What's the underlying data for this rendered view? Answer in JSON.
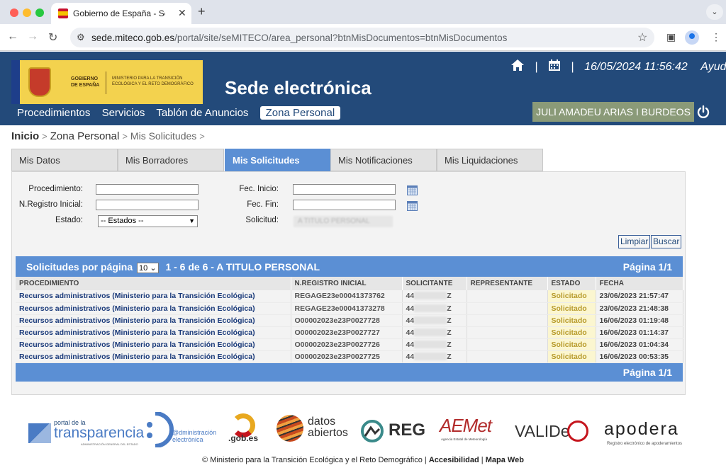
{
  "browser": {
    "tab_title": "Gobierno de España - Sede E",
    "url_host": "sede.miteco.gob.es",
    "url_path": "/portal/site/seMITECO/area_personal?btnMisDocumentos=btnMisDocumentos"
  },
  "header": {
    "logo_line1": "GOBIERNO DE ESPAÑA",
    "logo_line2": "MINISTERIO PARA LA TRANSICIÓN ECOLÓGICA Y EL RETO DEMOGRÁFICO",
    "site_title": "Sede electrónica",
    "datetime": "16/05/2024 11:56:42",
    "help": "Ayuda",
    "nav": [
      "Procedimientos",
      "Servicios",
      "Tablón de Anuncios",
      "Zona Personal"
    ],
    "user": "JULI AMADEU ARIAS I BURDEOS"
  },
  "breadcrumb": {
    "home": "Inicio",
    "zone": "Zona Personal",
    "current": "Mis Solicitudes"
  },
  "tabs": [
    "Mis Datos",
    "Mis Borradores",
    "Mis Solicitudes",
    "Mis Notificaciones",
    "Mis Liquidaciones"
  ],
  "filters": {
    "procedimiento_label": "Procedimiento:",
    "nregistro_label": "N.Registro Inicial:",
    "estado_label": "Estado:",
    "estado_value": "-- Estados --",
    "fec_inicio_label": "Fec. Inicio:",
    "fec_fin_label": "Fec. Fin:",
    "solicitud_label": "Solicitud:",
    "solicitud_value": "A TITULO PERSONAL",
    "limpiar": "Limpiar",
    "buscar": "Buscar"
  },
  "results": {
    "per_page_label": "Solicitudes por página",
    "per_page_value": "10",
    "range": "1 - 6 de 6 - A TITULO PERSONAL",
    "page": "Página 1/1",
    "columns": [
      "PROCEDIMIENTO",
      "N.REGISTRO INICIAL",
      "SOLICITANTE",
      "REPRESENTANTE",
      "ESTADO",
      "FECHA"
    ],
    "rows": [
      {
        "proc": "Recursos administrativos (Ministerio para la Transición Ecológica)",
        "reg": "REGAGE23e00041373762",
        "sol_a": "44",
        "sol_b": "Z",
        "rep": "",
        "estado": "Solicitado",
        "fecha": "23/06/2023 21:57:47"
      },
      {
        "proc": "Recursos administrativos (Ministerio para la Transición Ecológica)",
        "reg": "REGAGE23e00041373278",
        "sol_a": "44",
        "sol_b": "Z",
        "rep": "",
        "estado": "Solicitado",
        "fecha": "23/06/2023 21:48:38"
      },
      {
        "proc": "Recursos administrativos (Ministerio para la Transición Ecológica)",
        "reg": "O00002023e23P0027728",
        "sol_a": "44",
        "sol_b": "Z",
        "rep": "",
        "estado": "Solicitado",
        "fecha": "16/06/2023 01:19:48"
      },
      {
        "proc": "Recursos administrativos (Ministerio para la Transición Ecológica)",
        "reg": "O00002023e23P0027727",
        "sol_a": "44",
        "sol_b": "Z",
        "rep": "",
        "estado": "Solicitado",
        "fecha": "16/06/2023 01:14:37"
      },
      {
        "proc": "Recursos administrativos (Ministerio para la Transición Ecológica)",
        "reg": "O00002023e23P0027726",
        "sol_a": "44",
        "sol_b": "Z",
        "rep": "",
        "estado": "Solicitado",
        "fecha": "16/06/2023 01:04:34"
      },
      {
        "proc": "Recursos administrativos (Ministerio para la Transición Ecológica)",
        "reg": "O00002023e23P0027725",
        "sol_a": "44",
        "sol_b": "Z",
        "rep": "",
        "estado": "Solicitado",
        "fecha": "16/06/2023 00:53:35"
      }
    ]
  },
  "footer": {
    "logo_transparencia_small": "portal de la",
    "logo_transparencia": "transparencia",
    "logo_transparencia_sub": "ADMINISTRACIÓN GENERAL DEL ESTADO",
    "logo_admin": "@dministración electrónica",
    "logo_gob": ".gob.es",
    "logo_datos1": "datos",
    "logo_datos2": "abiertos",
    "logo_reg": "REG",
    "logo_aemet": "AEMet",
    "logo_aemet_sub": "Agencia Estatal de Meteorología",
    "logo_valide": "VALIDe",
    "logo_apodera": "apodera",
    "logo_apodera_sub": "Registro electrónico de apoderamientos",
    "copyright": "© Ministerio para la Transición Ecológica y el Reto Demográfico",
    "accesibilidad": "Accesibilidad",
    "mapa": "Mapa Web"
  },
  "colors": {
    "header_bg": "#234a7a",
    "tab_active": "#5b8fd4",
    "user_box": "#8a9a78",
    "estado_bg": "#fbf6d0"
  }
}
